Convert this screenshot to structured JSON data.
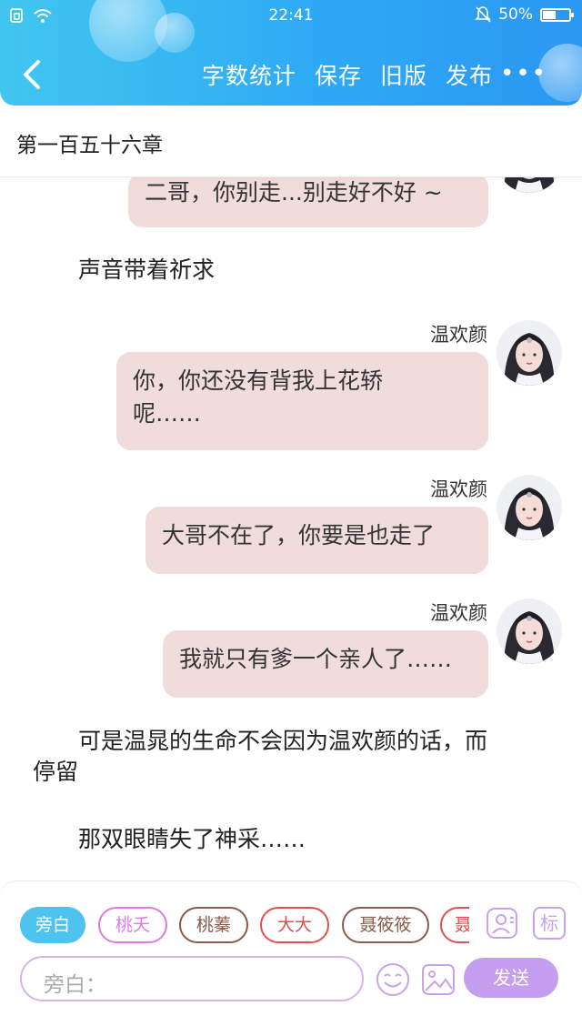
{
  "status_bar": {
    "time": "22:41",
    "battery": "50%",
    "battery_level": 0.5
  },
  "header": {
    "actions": [
      "字数统计",
      "保存",
      "旧版",
      "发布"
    ],
    "more": "•••"
  },
  "chapter_title": "第一百五十六章",
  "messages": {
    "m0": {
      "text": "二哥，你别走...别走好不好 ~"
    },
    "n1": {
      "text": "声音带着祈求"
    },
    "m1": {
      "name": "温欢颜",
      "line1": "你，你还没有背我上花轿",
      "line2": "呢……"
    },
    "m2": {
      "name": "温欢颜",
      "text": "大哥不在了，你要是也走了"
    },
    "m3": {
      "name": "温欢颜",
      "text": "我就只有爹一个亲人了……"
    },
    "n2": {
      "line1": "可是温晁的生命不会因为温欢颜的话，而",
      "line2": "停留"
    },
    "n3": {
      "text": "那双眼睛失了神采……"
    }
  },
  "roles": [
    "旁白",
    "桃夭",
    "桃蓁",
    "大大",
    "聂筱筱",
    "聂"
  ],
  "role_colors": [
    "#4fc3f0",
    "#e07ae0",
    "#8a5a4a",
    "#e05050",
    "#8a5a4a",
    "#e05050"
  ],
  "tools": {
    "profile_icon": "person-card-icon",
    "tag_label": "标"
  },
  "input": {
    "placeholder": "旁白："
  },
  "send_label": "发送"
}
